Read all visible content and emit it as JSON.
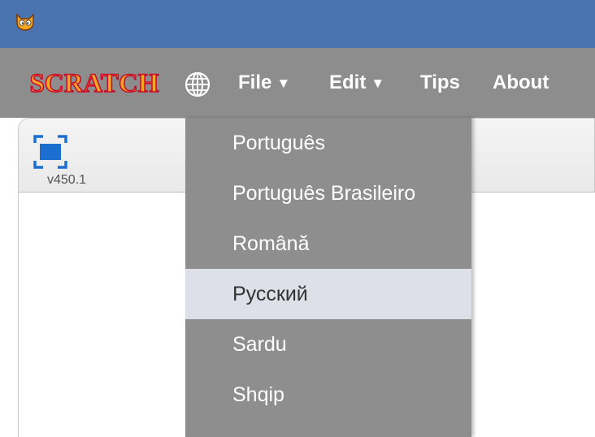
{
  "menubar": {
    "logo_text": "SCRATCH",
    "items": [
      {
        "label": "File",
        "has_caret": true
      },
      {
        "label": "Edit",
        "has_caret": true
      },
      {
        "label": "Tips",
        "has_caret": false
      },
      {
        "label": "About",
        "has_caret": false
      }
    ],
    "caret_glyph": "▼"
  },
  "stage": {
    "version": "v450.1"
  },
  "language_menu": {
    "items": [
      {
        "label": "Português"
      },
      {
        "label": "Português Brasileiro"
      },
      {
        "label": "Română"
      },
      {
        "label": "Русский",
        "selected": true
      },
      {
        "label": "Sardu"
      },
      {
        "label": "Shqip"
      }
    ]
  },
  "icons": {
    "app": "scratch-cat-icon",
    "language": "globe-icon",
    "fullscreen": "fullscreen-icon"
  },
  "colors": {
    "titlebar": "#4a74b0",
    "menubar": "#8d8d8d",
    "dropdown": "#8e8e8e",
    "selected_item": "#dde0e8",
    "logo_fill": "#f5a623",
    "logo_outline": "#c8102e",
    "fullscreen_icon": "#1a6fd1"
  }
}
